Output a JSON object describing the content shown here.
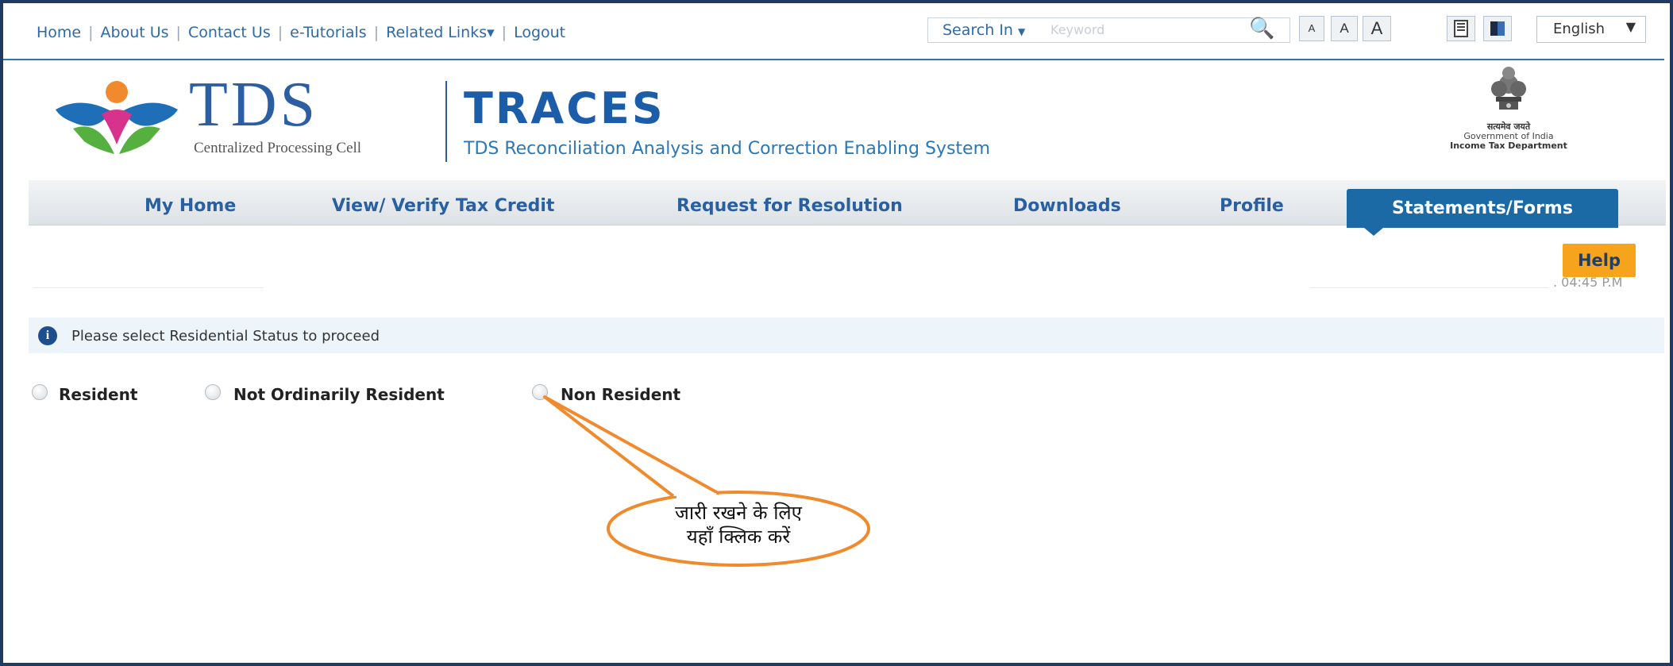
{
  "topbar": {
    "links": [
      "Home",
      "About Us",
      "Contact Us",
      "e-Tutorials",
      "Related Links▾",
      "Logout"
    ],
    "search_label": "Search In",
    "search_placeholder": "Keyword",
    "font_buttons": [
      "A",
      "A",
      "A"
    ],
    "language": "English"
  },
  "header": {
    "logo_text": "TDS",
    "logo_subtitle": "Centralized Processing Cell",
    "app_title": "TRACES",
    "app_subtitle": "TDS Reconciliation Analysis and Correction Enabling System",
    "emblem_line1": "सत्यमेव जयते",
    "emblem_line2": "Government of India",
    "emblem_line3": "Income Tax Department"
  },
  "nav": {
    "items": [
      "My Home",
      "View/ Verify Tax Credit",
      "Request for Resolution",
      "Downloads",
      "Profile",
      "Statements/Forms"
    ],
    "active": "Statements/Forms"
  },
  "help_label": "Help",
  "time_fragment": ". 04:45 P.M",
  "info": {
    "message": "Please select Residential Status to proceed"
  },
  "residential_status": {
    "options": [
      "Resident",
      "Not Ordinarily Resident",
      "Non Resident"
    ]
  },
  "callout": {
    "line1": "जारी रखने के लिए",
    "line2": "यहाँ क्लिक करें"
  },
  "colors": {
    "accent_blue": "#1c6aa5",
    "help_orange": "#f6a41b",
    "callout_orange": "#f08a2c"
  }
}
